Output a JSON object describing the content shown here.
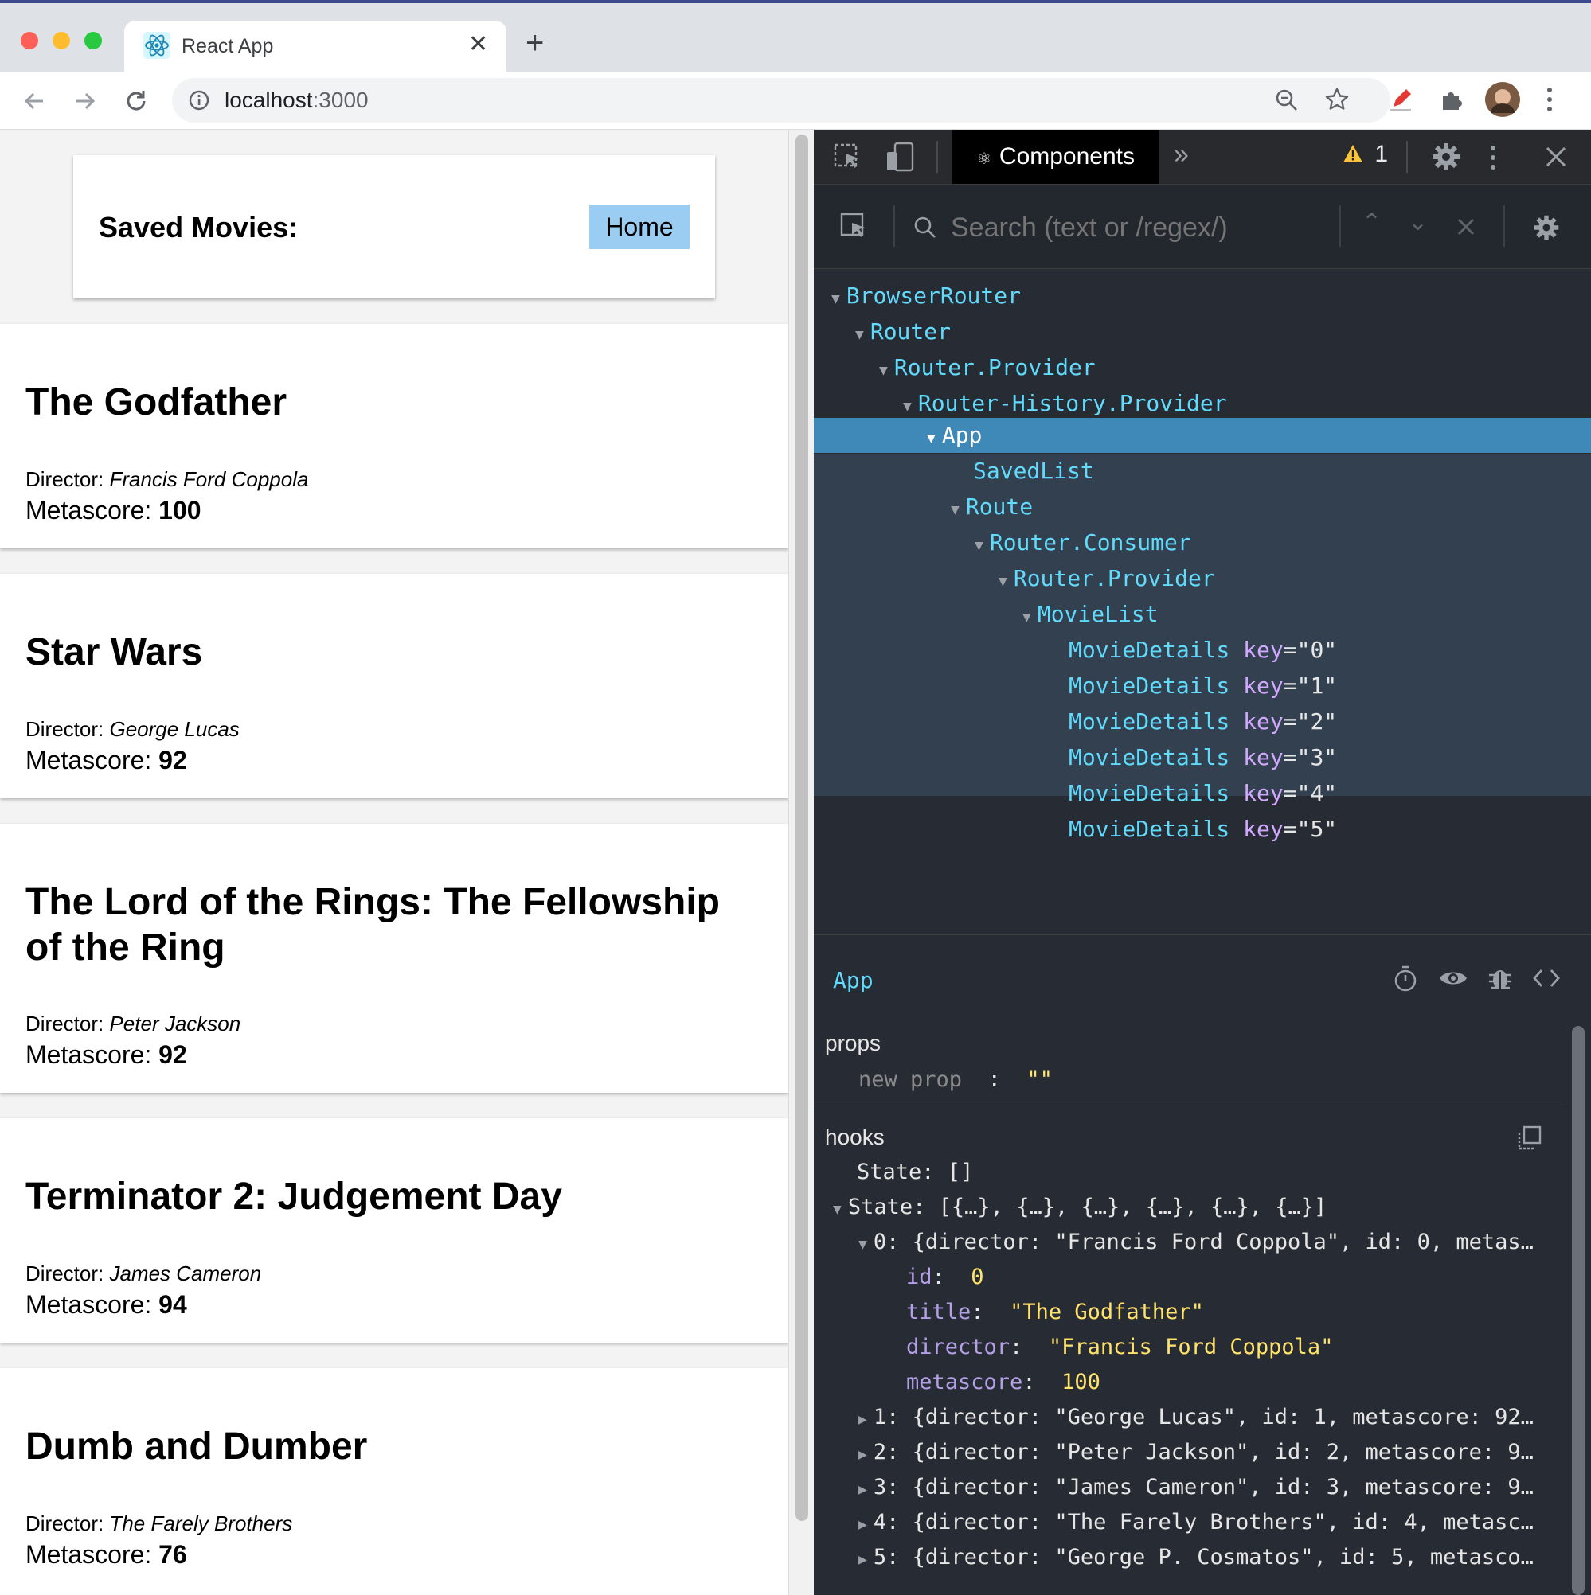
{
  "browser": {
    "tab_title": "React App",
    "url_host": "localhost",
    "url_port": ":3000",
    "close_glyph": "✕",
    "newtab_glyph": "+"
  },
  "page": {
    "saved_label": "Saved Movies:",
    "home_label": "Home",
    "director_label": "Director: ",
    "metascore_label": "Metascore: ",
    "movies": [
      {
        "title": "The Godfather",
        "director": "Francis Ford Coppola",
        "metascore": "100"
      },
      {
        "title": "Star Wars",
        "director": "George Lucas",
        "metascore": "92"
      },
      {
        "title": "The Lord of the Rings: The Fellowship of the Ring",
        "director": "Peter Jackson",
        "metascore": "92"
      },
      {
        "title": "Terminator 2: Judgement Day",
        "director": "James Cameron",
        "metascore": "94"
      },
      {
        "title": "Dumb and Dumber",
        "director": "The Farely Brothers",
        "metascore": "76"
      }
    ]
  },
  "devtools": {
    "components_tab": "Components",
    "warning_count": "1",
    "search_placeholder": "Search (text or /regex/)",
    "tree": {
      "browser_router": "BrowserRouter",
      "router": "Router",
      "router_provider": "Router.Provider",
      "history_provider": "Router-History.Provider",
      "app": "App",
      "saved_list": "SavedList",
      "route": "Route",
      "router_consumer": "Router.Consumer",
      "router_provider_2": "Router.Provider",
      "movie_list": "MovieList",
      "movie_details_label": "MovieDetails",
      "key_attr": "key",
      "movie_details_keys": [
        "=\"0\"",
        "=\"1\"",
        "=\"2\"",
        "=\"3\"",
        "=\"4\"",
        "=\"5\""
      ]
    },
    "selected_component": "App",
    "props_heading": "props",
    "new_prop": "new prop",
    "new_prop_sep": ":",
    "new_prop_value": "\"\"",
    "hooks_heading": "hooks",
    "state1_label": "State:",
    "state1_value": "[]",
    "state2_label": "State:",
    "state2_value": "[{…}, {…}, {…}, {…}, {…}, {…}]",
    "item0_summary": "0: {director: \"Francis Ford Coppola\", id: 0, metas…",
    "item0_fields": [
      {
        "key": "id",
        "value": "0"
      },
      {
        "key": "title",
        "value": "\"The Godfather\""
      },
      {
        "key": "director",
        "value": "\"Francis Ford Coppola\""
      },
      {
        "key": "metascore",
        "value": "100"
      }
    ],
    "collapsed_items": [
      "1: {director: \"George Lucas\", id: 1, metascore: 92…",
      "2: {director: \"Peter Jackson\", id: 2, metascore: 9…",
      "3: {director: \"James Cameron\", id: 3, metascore: 9…",
      "4: {director: \"The Farely Brothers\", id: 4, metasc…",
      "5: {director: \"George P. Cosmatos\", id: 5, metasco…"
    ]
  },
  "colors": {
    "react_cyan": "#61dafb",
    "selected_row": "#3f89b8",
    "home_button": "#9bcdf3",
    "string_yellow": "#ffe36b"
  }
}
